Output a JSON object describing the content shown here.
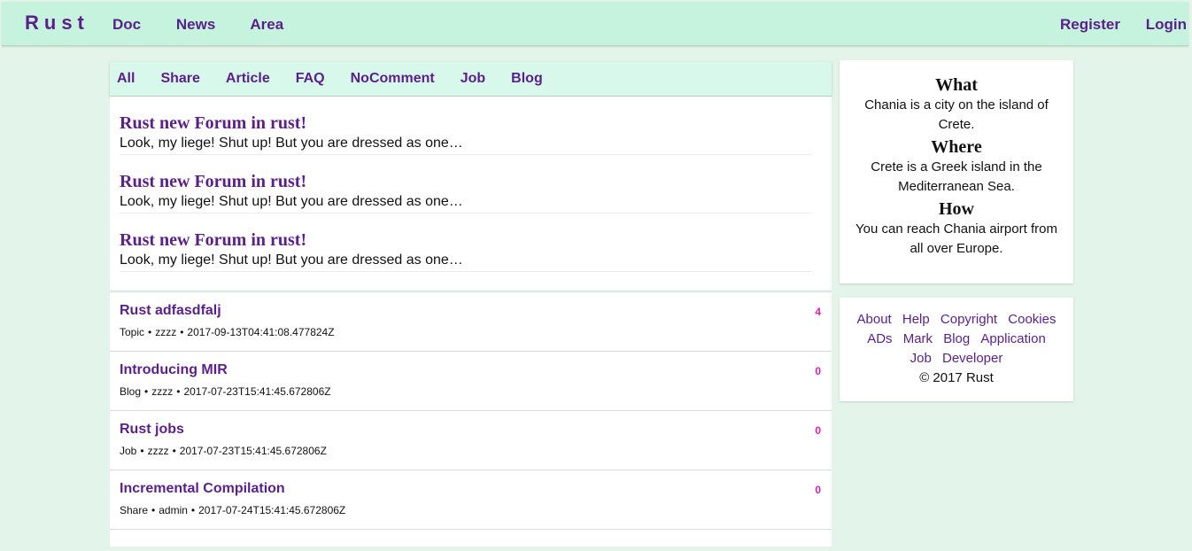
{
  "topbar": {
    "brand": "Rust",
    "nav": [
      "Doc",
      "News",
      "Area"
    ],
    "auth": [
      "Register",
      "Login"
    ]
  },
  "tabs": [
    "All",
    "Share",
    "Article",
    "FAQ",
    "NoComment",
    "Job",
    "Blog"
  ],
  "featured": [
    {
      "title": "Rust new Forum in rust!",
      "body": "Look, my liege! Shut up! But you are dressed as one…"
    },
    {
      "title": "Rust new Forum in rust!",
      "body": "Look, my liege! Shut up! But you are dressed as one…"
    },
    {
      "title": "Rust new Forum in rust!",
      "body": "Look, my liege! Shut up! But you are dressed as one…"
    }
  ],
  "topics": [
    {
      "title": "Rust adfasdfalj",
      "category": "Topic",
      "author": "zzzz",
      "time": "2017-09-13T04:41:08.477824Z",
      "count": "4"
    },
    {
      "title": "Introducing MIR",
      "category": "Blog",
      "author": "zzzz",
      "time": "2017-07-23T15:41:45.672806Z",
      "count": "0"
    },
    {
      "title": "Rust jobs",
      "category": "Job",
      "author": "zzzz",
      "time": "2017-07-23T15:41:45.672806Z",
      "count": "0"
    },
    {
      "title": "Incremental Compilation",
      "category": "Share",
      "author": "admin",
      "time": "2017-07-24T15:41:45.672806Z",
      "count": "0"
    }
  ],
  "meta_separator": "•",
  "info": {
    "what_title": "What",
    "what_text": "Chania is a city on the island of Crete.",
    "where_title": "Where",
    "where_text": "Crete is a Greek island in the Mediterranean Sea.",
    "how_title": "How",
    "how_text": "You can reach Chania airport from all over Europe."
  },
  "footer_links": [
    "About",
    "Help",
    "Copyright",
    "Cookies",
    "ADs",
    "Mark",
    "Blog",
    "Application",
    "Job",
    "Developer"
  ],
  "copyright": "© 2017 Rust",
  "colors": {
    "page_bg": "#e3f5ea",
    "topbar_bg": "#c5f3de",
    "tabbar_bg": "#d7f8ea",
    "link": "#5b1f8a",
    "count": "#e01fb7"
  }
}
